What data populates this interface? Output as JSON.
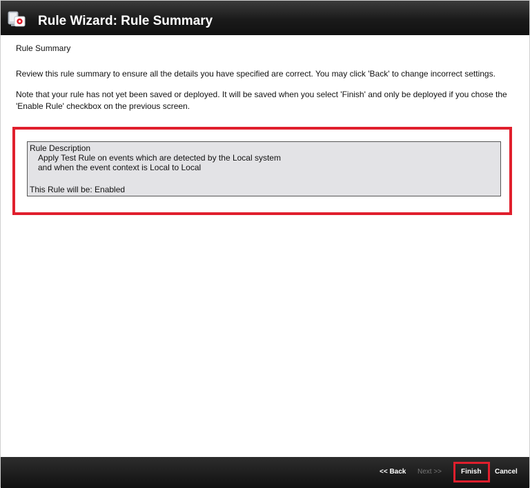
{
  "window": {
    "title": "Rule Wizard: Rule Summary"
  },
  "content": {
    "heading": "Rule Summary",
    "review_text": "Review this rule summary to ensure all the details you have specified are correct. You may click 'Back' to change incorrect settings.",
    "note_text": "Note that your rule has not yet been saved or deployed. It will be saved when you select 'Finish' and only be deployed if you chose the 'Enable Rule' checkbox on the previous screen."
  },
  "rule_description": {
    "label": "Rule Description",
    "line1": "Apply Test Rule on events which are detected by the Local system",
    "line2": "and when the event context is Local to Local",
    "status": "This Rule will be: Enabled"
  },
  "footer": {
    "back_label": "<< Back",
    "next_label": "Next >>",
    "finish_label": "Finish",
    "cancel_label": "Cancel"
  },
  "colors": {
    "highlight": "#e01f2d",
    "titlebar": "#1a1a1a",
    "description_bg": "#e3e3e6"
  }
}
